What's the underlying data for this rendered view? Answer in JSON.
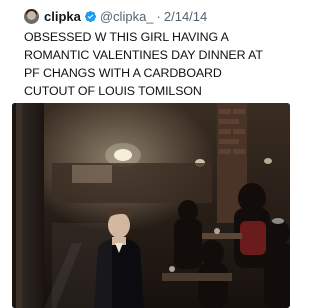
{
  "tweet": {
    "display_name": "clipka",
    "handle": "@clipka_",
    "separator": "·",
    "date": "2/14/14",
    "text": "OBSESSED W THIS GIRL HAVING A\nROMANTIC VALENTINES DAY DINNER AT\nPF CHANGS WITH A CARDBOARD\nCUTOUT OF LOUIS TOMILSON",
    "verified_icon": "verified-badge-icon",
    "colors": {
      "verified": "#1d9bf0",
      "secondary_text": "#536471",
      "primary_text": "#0f1419"
    }
  },
  "media": {
    "description_icon": "restaurant-photo"
  }
}
